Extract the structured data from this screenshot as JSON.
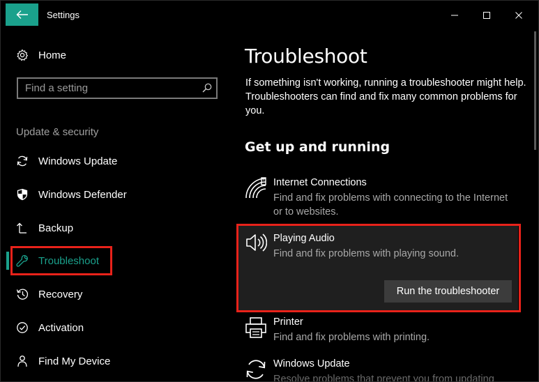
{
  "window": {
    "title": "Settings"
  },
  "sidebar": {
    "home_label": "Home",
    "search_placeholder": "Find a setting",
    "section_heading": "Update & security",
    "items": [
      {
        "label": "Windows Update",
        "icon": "sync-icon"
      },
      {
        "label": "Windows Defender",
        "icon": "shield-icon"
      },
      {
        "label": "Backup",
        "icon": "backup-arrow-icon"
      },
      {
        "label": "Troubleshoot",
        "icon": "wrench-icon",
        "active": true
      },
      {
        "label": "Recovery",
        "icon": "history-icon"
      },
      {
        "label": "Activation",
        "icon": "check-circle-icon"
      },
      {
        "label": "Find My Device",
        "icon": "person-pin-icon"
      }
    ]
  },
  "main": {
    "title": "Troubleshoot",
    "description": "If something isn't working, running a troubleshooter might help. Troubleshooters can find and fix many common problems for you.",
    "group_heading": "Get up and running",
    "troubleshooters": [
      {
        "title": "Internet Connections",
        "desc": "Find and fix problems with connecting to the Internet or to websites.",
        "icon": "wifi-icon"
      },
      {
        "title": "Playing Audio",
        "desc": "Find and fix problems with playing sound.",
        "icon": "speaker-icon",
        "selected": true,
        "button": "Run the troubleshooter"
      },
      {
        "title": "Printer",
        "desc": "Find and fix problems with printing.",
        "icon": "printer-icon"
      },
      {
        "title": "Windows Update",
        "desc": "Resolve problems that prevent you from updating",
        "icon": "sync-icon"
      }
    ]
  },
  "colors": {
    "accent": "#1aa18c",
    "highlight": "#e8221a",
    "panel": "#1f1f1f"
  }
}
